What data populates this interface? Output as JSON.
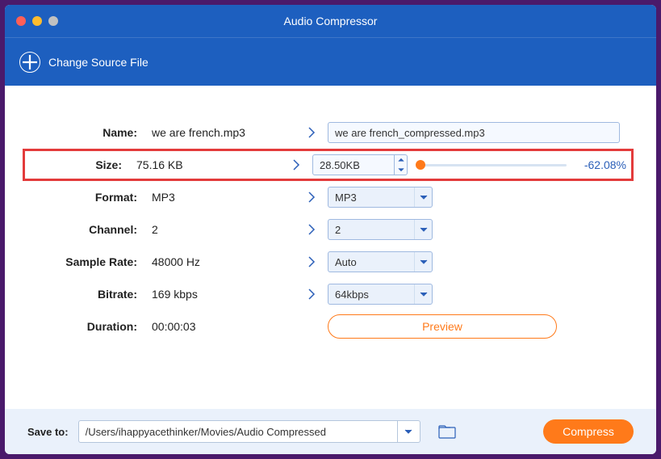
{
  "title": "Audio Compressor",
  "toolbar": {
    "change_source": "Change Source File"
  },
  "rows": {
    "name": {
      "label": "Name:",
      "orig": "we are french.mp3",
      "target": "we are french_compressed.mp3"
    },
    "size": {
      "label": "Size:",
      "orig": "75.16 KB",
      "target": "28.50KB",
      "pct": "-62.08%"
    },
    "format": {
      "label": "Format:",
      "orig": "MP3",
      "target": "MP3"
    },
    "channel": {
      "label": "Channel:",
      "orig": "2",
      "target": "2"
    },
    "srate": {
      "label": "Sample Rate:",
      "orig": "48000 Hz",
      "target": "Auto"
    },
    "bitrate": {
      "label": "Bitrate:",
      "orig": "169 kbps",
      "target": "64kbps"
    },
    "duration": {
      "label": "Duration:",
      "orig": "00:00:03"
    }
  },
  "preview_label": "Preview",
  "footer": {
    "save_label": "Save to:",
    "path": "/Users/ihappyacethinker/Movies/Audio Compressed",
    "compress_label": "Compress"
  }
}
